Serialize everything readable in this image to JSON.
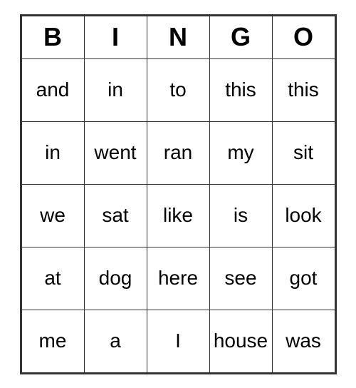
{
  "header": {
    "cols": [
      "B",
      "I",
      "N",
      "G",
      "O"
    ]
  },
  "rows": [
    [
      "and",
      "in",
      "to",
      "this",
      "this"
    ],
    [
      "in",
      "went",
      "ran",
      "my",
      "sit"
    ],
    [
      "we",
      "sat",
      "like",
      "is",
      "look"
    ],
    [
      "at",
      "dog",
      "here",
      "see",
      "got"
    ],
    [
      "me",
      "a",
      "I",
      "house",
      "was"
    ]
  ]
}
